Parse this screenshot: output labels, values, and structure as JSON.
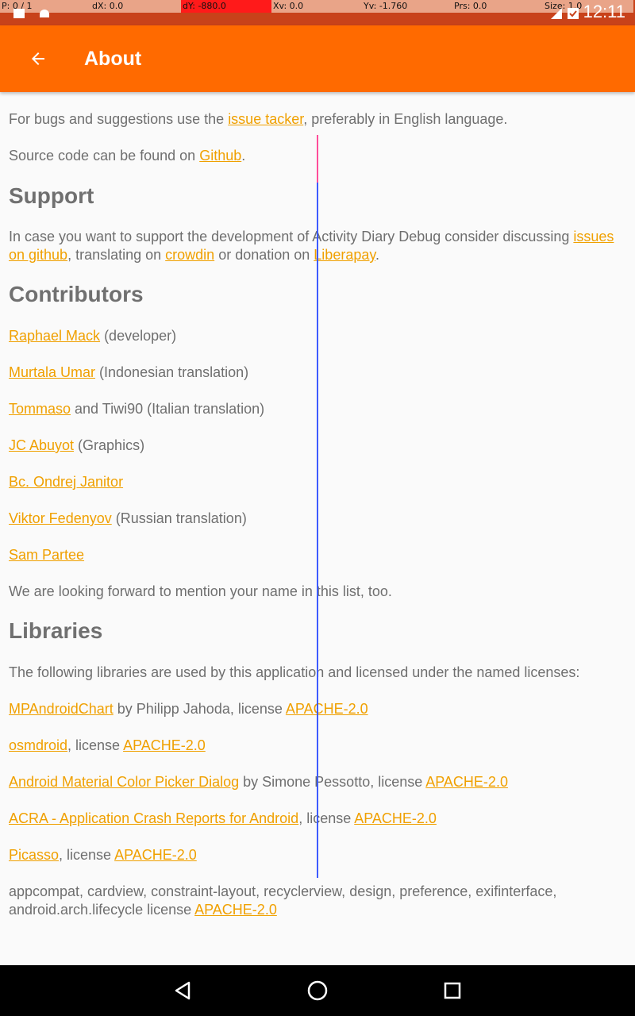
{
  "status_bar": {
    "time": "12:11",
    "pointer_info": [
      "P: 0 / 1",
      "dX: 0.0",
      "dY: -880.0",
      "Xv: 0.0",
      "Yv: -1.760",
      "Prs: 0.0",
      "Size: 1.0"
    ]
  },
  "appbar": {
    "title": "About"
  },
  "content": {
    "bugs": {
      "pre": "For bugs and suggestions use the ",
      "link": "issue tacker",
      "post": ", preferably in English language."
    },
    "source": {
      "pre": "Source code can be found on ",
      "link": "Github",
      "post": "."
    },
    "support_heading": "Support",
    "support": {
      "pre": "In case you want to support the development of Activity Diary Debug consider discussing ",
      "link1": "issues on github",
      "mid1": ", translating on ",
      "link2": "crowdin",
      "mid2": " or donation on ",
      "link3": "Liberapay",
      "post": "."
    },
    "contributors_heading": "Contributors",
    "contributors": [
      {
        "link": "Raphael Mack",
        "text": " (developer)"
      },
      {
        "link": "Murtala Umar",
        "text": " (Indonesian translation)"
      },
      {
        "link": "Tommaso",
        "text": " and Tiwi90 (Italian translation)"
      },
      {
        "link": "JC Abuyot",
        "text": " (Graphics)"
      },
      {
        "link": "Bc. Ondrej Janitor",
        "text": ""
      },
      {
        "link": "Viktor Fedenyov",
        "text": " (Russian translation)"
      },
      {
        "link": "Sam Partee",
        "text": ""
      }
    ],
    "forward": "We are looking forward to mention your name in this list, too.",
    "libraries_heading": "Libraries",
    "libraries_intro": "The following libraries are used by this application and licensed under the named licenses:",
    "libraries": [
      {
        "link": "MPAndroidChart",
        "text": " by Philipp Jahoda, license ",
        "license": "APACHE-2.0"
      },
      {
        "link": "osmdroid",
        "text": ", license ",
        "license": "APACHE-2.0"
      },
      {
        "link": "Android Material Color Picker Dialog",
        "text": " by Simone Pessotto, license ",
        "license": "APACHE-2.0"
      },
      {
        "link": "ACRA - Application Crash Reports for Android",
        "text": ", license ",
        "license": "APACHE-2.0"
      },
      {
        "link": "Picasso",
        "text": ", license ",
        "license": "APACHE-2.0"
      }
    ],
    "support_libs": {
      "text": "appcompat, cardview, constraint-layout, recyclerview, design, preference, exifinterface, android.arch.lifecycle license ",
      "license": "APACHE-2.0"
    }
  },
  "colors": {
    "appbar": "#ff6a00",
    "link": "#f0a000",
    "statusbar": "#c8421a"
  },
  "icons": {
    "back": "arrow-back-icon",
    "nav_back": "triangle-back-icon",
    "nav_home": "circle-home-icon",
    "nav_recents": "square-recents-icon"
  }
}
